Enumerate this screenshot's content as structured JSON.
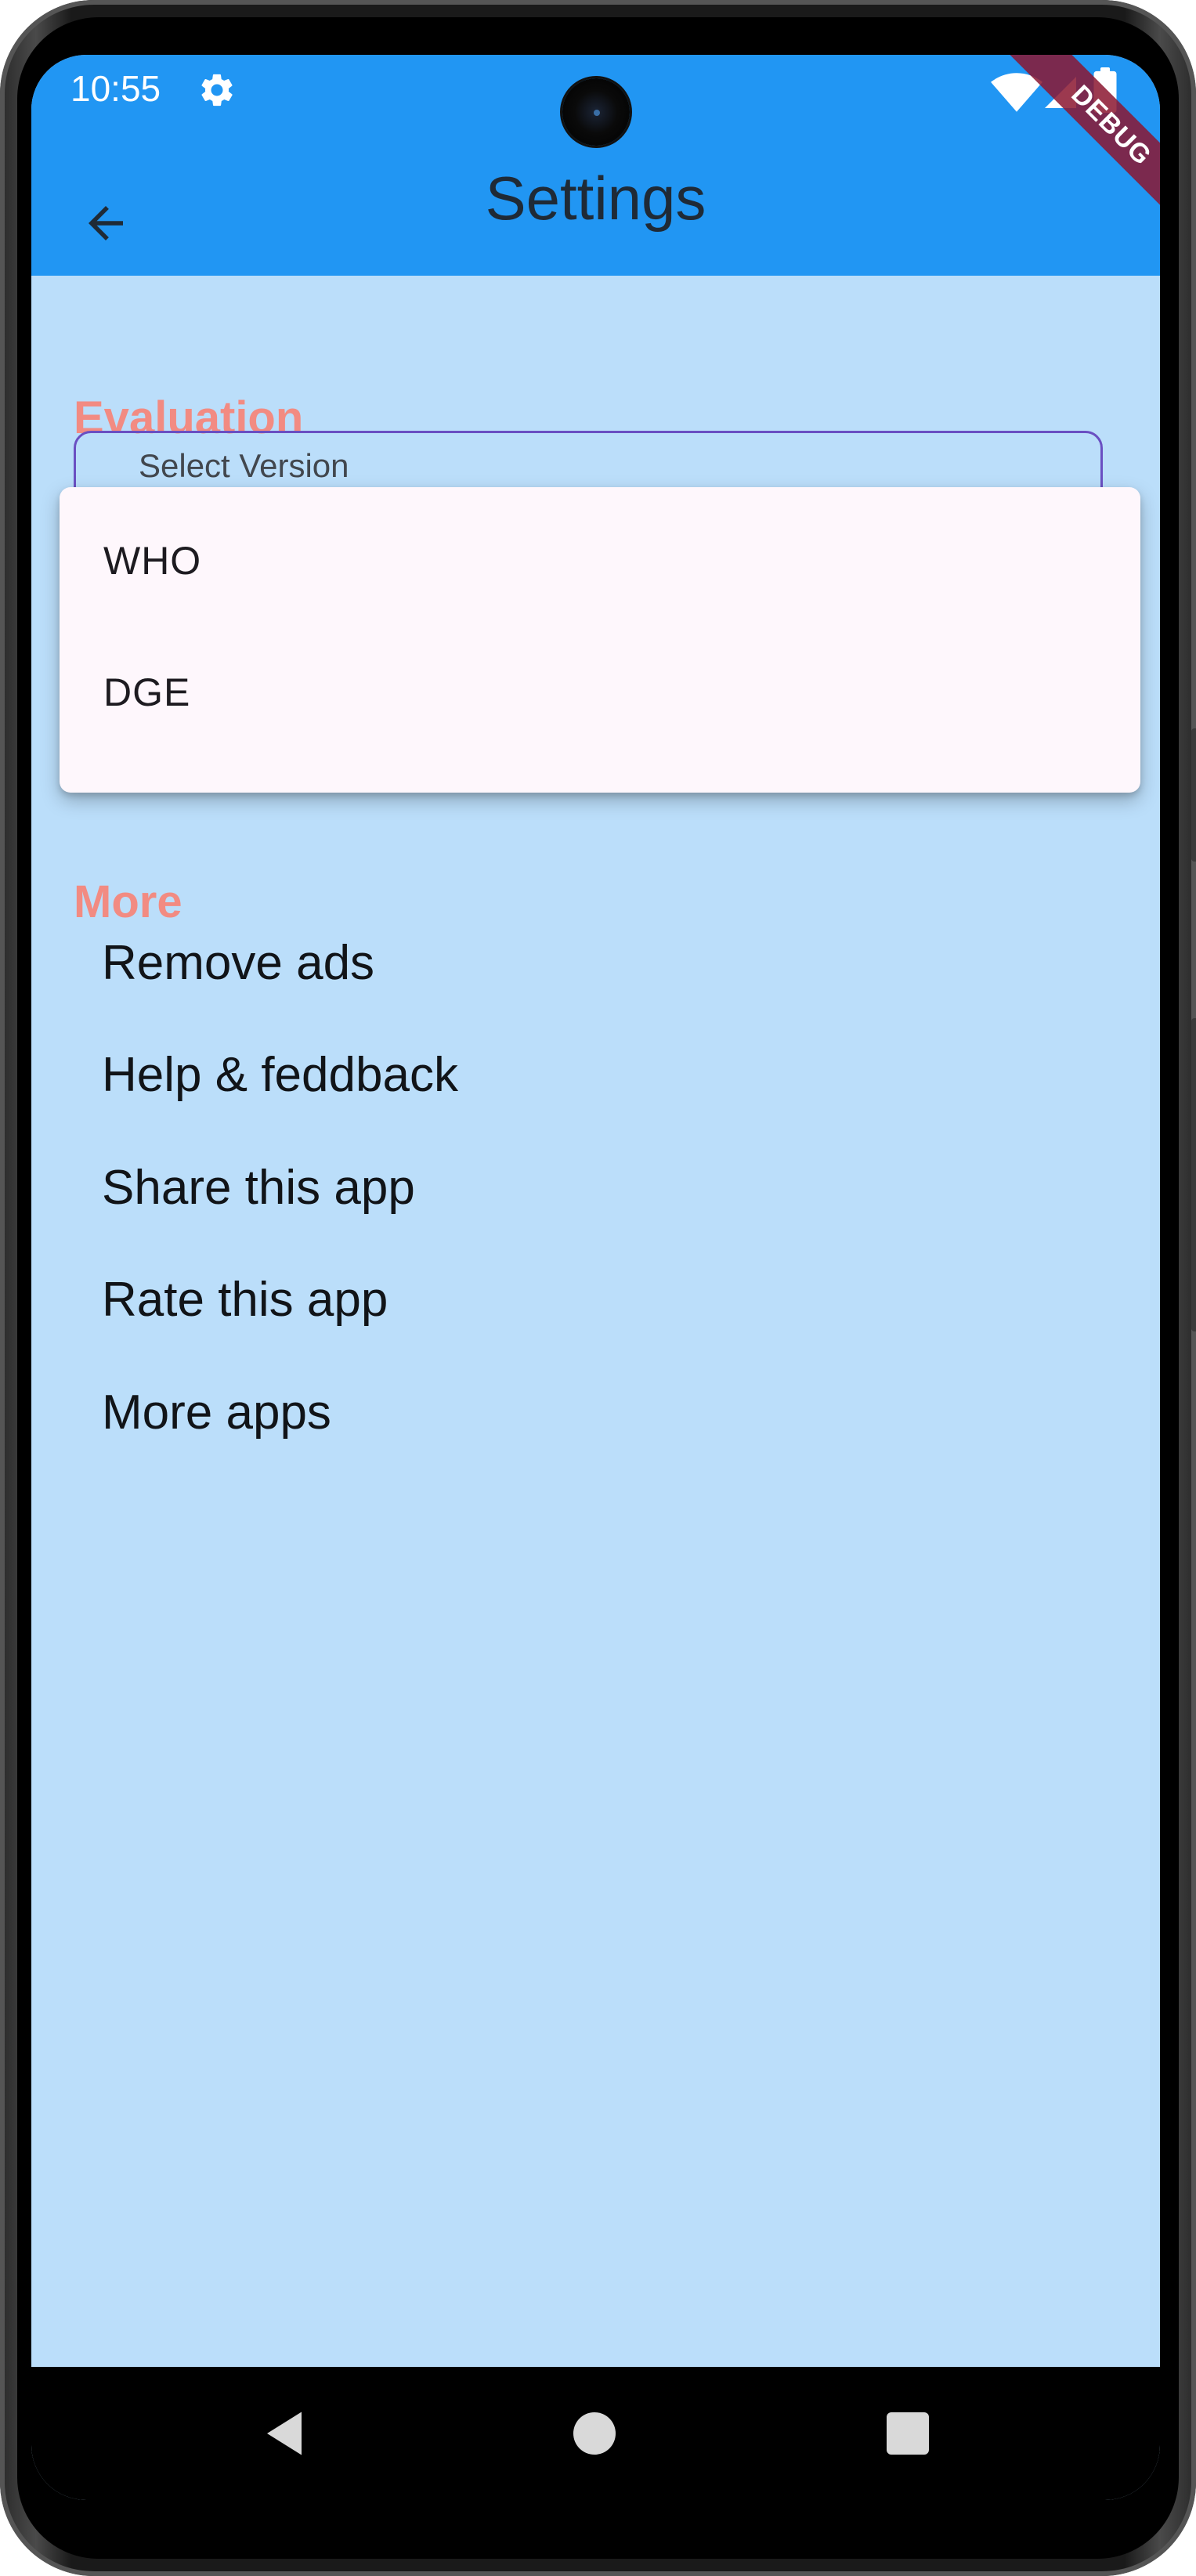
{
  "status_bar": {
    "time": "10:55"
  },
  "app_bar": {
    "title": "Settings",
    "debug_banner": "DEBUG"
  },
  "sections": {
    "evaluation_title": "Evaluation",
    "more_title": "More"
  },
  "select": {
    "label": "Select Version",
    "options": [
      "WHO",
      "DGE"
    ]
  },
  "more_items": [
    "Remove ads",
    "Help & feddback",
    "Share this app",
    "Rate this app",
    "More apps"
  ],
  "colors": {
    "app_bar": "#2196f3",
    "background": "#bbdefa",
    "section_title": "#f28b82",
    "menu_background": "#fef7fc",
    "field_border": "#6a4fc2"
  },
  "icons": {
    "back": "arrow-back-icon",
    "status_settings": "gear-icon",
    "wifi": "wifi-icon",
    "signal": "signal-icon",
    "battery": "battery-icon"
  }
}
